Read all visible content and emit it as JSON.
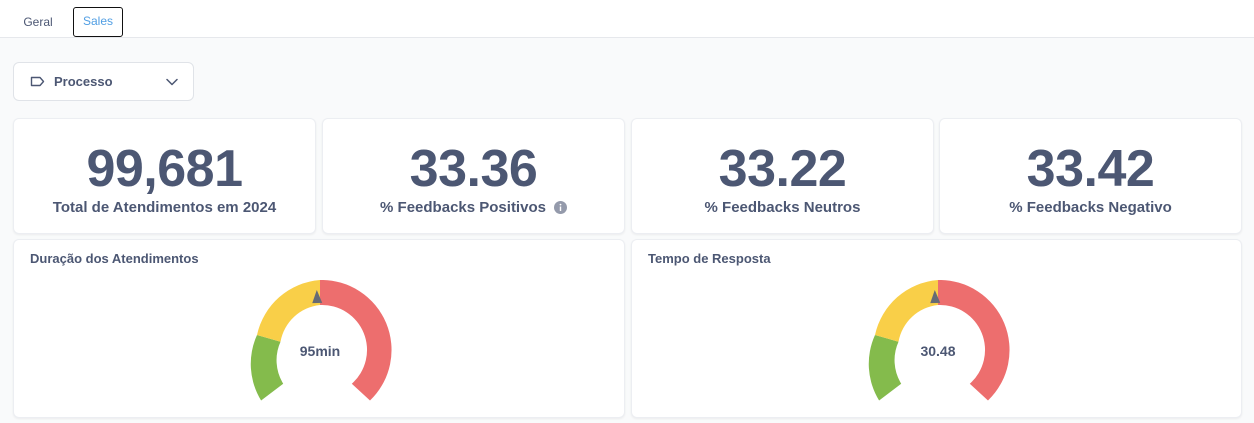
{
  "tabs": [
    {
      "label": "Geral",
      "active": false
    },
    {
      "label": "Sales",
      "active": true
    }
  ],
  "filter": {
    "label": "Processo",
    "icon": "tag-icon"
  },
  "kpis": [
    {
      "value": "99,681",
      "caption": "Total de Atendimentos em 2024",
      "info": false
    },
    {
      "value": "33.36",
      "caption": "% Feedbacks Positivos",
      "info": true
    },
    {
      "value": "33.22",
      "caption": "% Feedbacks Neutros",
      "info": false
    },
    {
      "value": "33.42",
      "caption": "% Feedbacks Negativo",
      "info": false
    }
  ],
  "gauges": [
    {
      "title": "Duração dos Atendimentos",
      "value_label": "95min"
    },
    {
      "title": "Tempo de Resposta",
      "value_label": "30.48"
    }
  ],
  "colors": {
    "green": "#84bb4c",
    "yellow": "#f9cf48",
    "red": "#ed6e6e",
    "text": "#4c5773",
    "accent": "#509ee3"
  }
}
